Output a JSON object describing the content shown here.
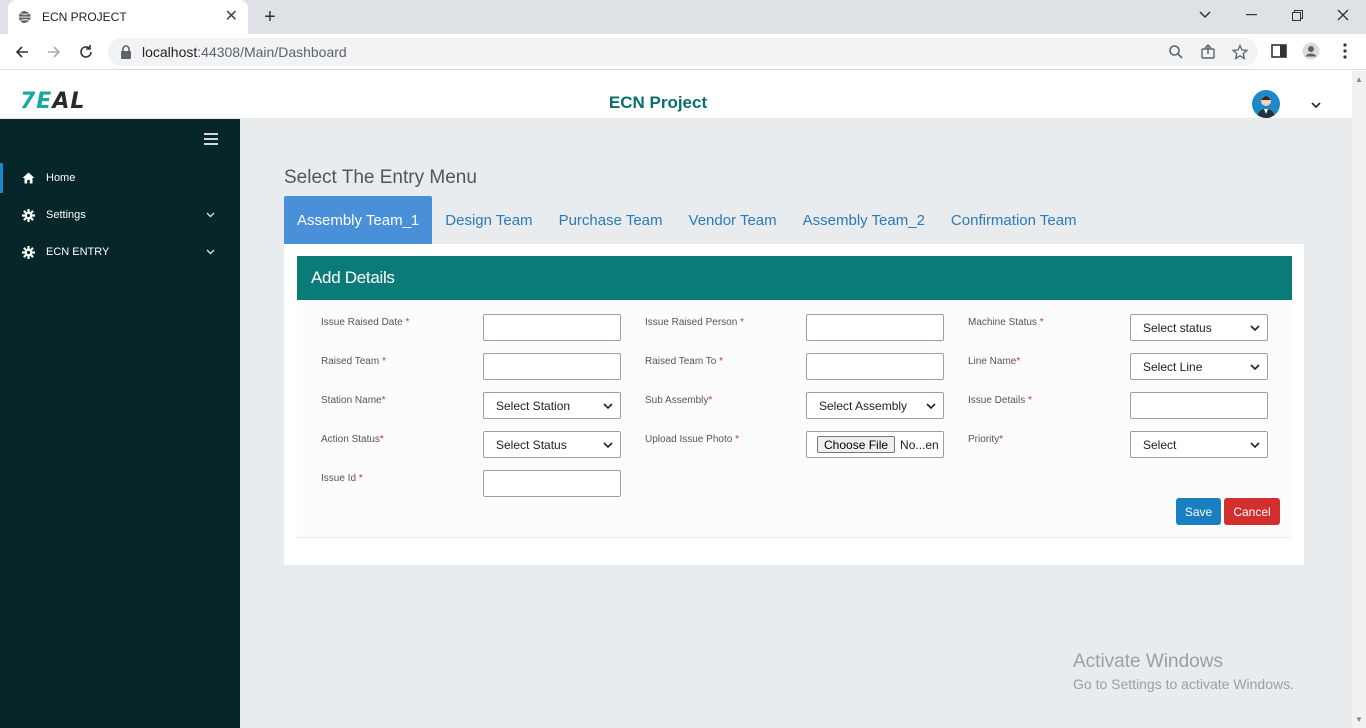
{
  "browser": {
    "tab_title": "ECN PROJECT",
    "tab_close": "✕",
    "new_tab": "+",
    "url_host": "localhost",
    "url_path": ":44308/Main/Dashboard"
  },
  "app": {
    "logo_part1": "7E",
    "logo_part2": "AL",
    "title": "ECN Project"
  },
  "sidebar": {
    "items": [
      {
        "label": "Home",
        "icon": "home-icon"
      },
      {
        "label": "Settings",
        "icon": "gear-icon"
      },
      {
        "label": "ECN ENTRY",
        "icon": "gear-icon"
      }
    ]
  },
  "page": {
    "heading": "Select The Entry Menu",
    "tabs": [
      {
        "label": "Assembly Team_1"
      },
      {
        "label": "Design Team"
      },
      {
        "label": "Purchase Team"
      },
      {
        "label": "Vendor Team"
      },
      {
        "label": "Assembly Team_2"
      },
      {
        "label": "Confirmation Team"
      }
    ]
  },
  "form": {
    "title": "Add Details",
    "required_mark": "*",
    "fields": {
      "issue_raised_date": {
        "label": "Issue Raised Date",
        "value": ""
      },
      "issue_raised_person": {
        "label": "Issue Raised Person",
        "value": ""
      },
      "machine_status": {
        "label": "Machine Status",
        "selected": "Select status"
      },
      "raised_team": {
        "label": "Raised Team",
        "value": ""
      },
      "raised_team_to": {
        "label": "Raised Team To",
        "value": ""
      },
      "line_name": {
        "label": "Line Name",
        "selected": "Select Line"
      },
      "station_name": {
        "label": "Station Name",
        "selected": "Select Station"
      },
      "sub_assembly": {
        "label": "Sub Assembly",
        "selected": "Select Assembly"
      },
      "issue_details": {
        "label": "Issue Details",
        "value": ""
      },
      "action_status": {
        "label": "Action Status",
        "selected": "Select Status"
      },
      "upload_issue_photo": {
        "label": "Upload Issue Photo",
        "button": "Choose File",
        "file_text": "No...en"
      },
      "priority": {
        "label": "Priority",
        "selected": "Select"
      },
      "issue_id": {
        "label": "Issue Id",
        "value": ""
      }
    },
    "save_label": "Save",
    "cancel_label": "Cancel"
  },
  "watermark": {
    "line1": "Activate Windows",
    "line2": "Go to Settings to activate Windows."
  },
  "colors": {
    "sidebar_bg": "#06262a",
    "card_header": "#0b7b78",
    "active_tab": "#4a90d9",
    "save": "#1a7fc1",
    "cancel": "#d32f2f"
  }
}
